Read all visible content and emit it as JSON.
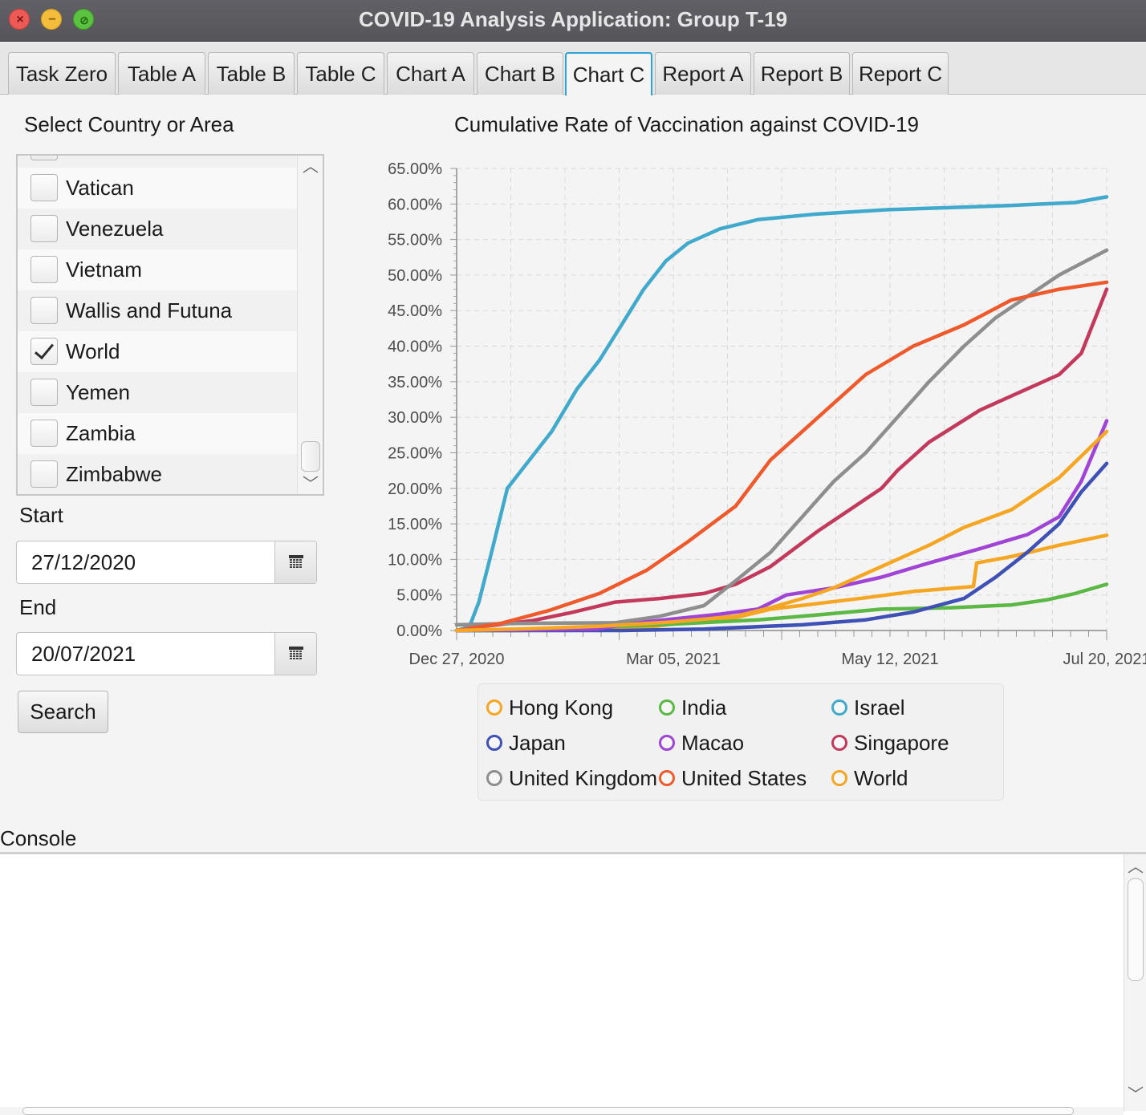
{
  "window": {
    "title": "COVID-19 Analysis Application: Group T-19"
  },
  "tabs": [
    {
      "label": "Task Zero",
      "active": false
    },
    {
      "label": "Table A",
      "active": false
    },
    {
      "label": "Table B",
      "active": false
    },
    {
      "label": "Table C",
      "active": false
    },
    {
      "label": "Chart A",
      "active": false
    },
    {
      "label": "Chart B",
      "active": false
    },
    {
      "label": "Chart C",
      "active": true
    },
    {
      "label": "Report A",
      "active": false
    },
    {
      "label": "Report B",
      "active": false
    },
    {
      "label": "Report C",
      "active": false
    }
  ],
  "sidebar": {
    "select_label": "Select Country or Area",
    "countries": [
      {
        "name": "Vatican",
        "checked": false
      },
      {
        "name": "Venezuela",
        "checked": false
      },
      {
        "name": "Vietnam",
        "checked": false
      },
      {
        "name": "Wallis and Futuna",
        "checked": false
      },
      {
        "name": "World",
        "checked": true
      },
      {
        "name": "Yemen",
        "checked": false
      },
      {
        "name": "Zambia",
        "checked": false
      },
      {
        "name": "Zimbabwe",
        "checked": false
      }
    ],
    "start_label": "Start",
    "start_value": "27/12/2020",
    "end_label": "End",
    "end_value": "20/07/2021",
    "search_label": "Search"
  },
  "console": {
    "label": "Console",
    "text": ""
  },
  "chart_data": {
    "type": "line",
    "title": "Cumulative Rate of Vaccination against COVID-19",
    "xlabel": "",
    "ylabel": "",
    "x_range": [
      "2020-12-27",
      "2021-07-20"
    ],
    "ylim": [
      0,
      65
    ],
    "yticks": [
      "0.00%",
      "5.00%",
      "10.00%",
      "15.00%",
      "20.00%",
      "25.00%",
      "30.00%",
      "35.00%",
      "40.00%",
      "45.00%",
      "50.00%",
      "55.00%",
      "60.00%",
      "65.00%"
    ],
    "xticks": [
      "Dec 27, 2020",
      "Mar 05, 2021",
      "May 12, 2021",
      "Jul 20, 2021"
    ],
    "grid": true,
    "legend_position": "bottom",
    "series": [
      {
        "name": "Hong Kong",
        "color": "#f5a623",
        "points": [
          [
            "2020-12-27",
            0
          ],
          [
            "2021-02-26",
            0.5
          ],
          [
            "2021-03-10",
            1.2
          ],
          [
            "2021-03-25",
            1.8
          ],
          [
            "2021-04-05",
            3
          ],
          [
            "2021-04-20",
            3.8
          ],
          [
            "2021-05-05",
            4.6
          ],
          [
            "2021-05-20",
            5.5
          ],
          [
            "2021-06-08",
            6.2
          ],
          [
            "2021-06-09",
            9.5
          ],
          [
            "2021-06-20",
            10.4
          ],
          [
            "2021-07-05",
            12
          ],
          [
            "2021-07-20",
            13.4
          ]
        ]
      },
      {
        "name": "India",
        "color": "#5cb845",
        "points": [
          [
            "2020-12-27",
            0
          ],
          [
            "2021-01-16",
            0
          ],
          [
            "2021-02-01",
            0.3
          ],
          [
            "2021-03-01",
            0.8
          ],
          [
            "2021-04-01",
            1.5
          ],
          [
            "2021-04-20",
            2.2
          ],
          [
            "2021-05-10",
            3
          ],
          [
            "2021-06-01",
            3.2
          ],
          [
            "2021-06-20",
            3.6
          ],
          [
            "2021-07-01",
            4.3
          ],
          [
            "2021-07-10",
            5.2
          ],
          [
            "2021-07-20",
            6.5
          ]
        ]
      },
      {
        "name": "Israel",
        "color": "#41a9cc",
        "points": [
          [
            "2020-12-27",
            0
          ],
          [
            "2020-12-31",
            0.5
          ],
          [
            "2021-01-03",
            4
          ],
          [
            "2021-01-07",
            11
          ],
          [
            "2021-01-12",
            20
          ],
          [
            "2021-01-19",
            24
          ],
          [
            "2021-01-26",
            28
          ],
          [
            "2021-02-03",
            34
          ],
          [
            "2021-02-10",
            38
          ],
          [
            "2021-02-17",
            43
          ],
          [
            "2021-02-24",
            48
          ],
          [
            "2021-03-03",
            52
          ],
          [
            "2021-03-10",
            54.5
          ],
          [
            "2021-03-20",
            56.5
          ],
          [
            "2021-04-01",
            57.8
          ],
          [
            "2021-04-20",
            58.6
          ],
          [
            "2021-05-12",
            59.2
          ],
          [
            "2021-06-01",
            59.5
          ],
          [
            "2021-06-20",
            59.8
          ],
          [
            "2021-07-10",
            60.2
          ],
          [
            "2021-07-20",
            61
          ]
        ]
      },
      {
        "name": "Japan",
        "color": "#3f51b5",
        "points": [
          [
            "2020-12-27",
            0
          ],
          [
            "2021-02-17",
            0
          ],
          [
            "2021-03-15",
            0.2
          ],
          [
            "2021-04-15",
            0.8
          ],
          [
            "2021-05-05",
            1.5
          ],
          [
            "2021-05-20",
            2.6
          ],
          [
            "2021-06-05",
            4.5
          ],
          [
            "2021-06-15",
            7.5
          ],
          [
            "2021-06-25",
            11
          ],
          [
            "2021-07-05",
            15
          ],
          [
            "2021-07-12",
            19.5
          ],
          [
            "2021-07-20",
            23.5
          ]
        ]
      },
      {
        "name": "Macao",
        "color": "#a044d6",
        "points": [
          [
            "2020-12-27",
            0
          ],
          [
            "2021-02-09",
            0.2
          ],
          [
            "2021-02-20",
            1
          ],
          [
            "2021-03-05",
            1.6
          ],
          [
            "2021-03-20",
            2.3
          ],
          [
            "2021-04-01",
            3
          ],
          [
            "2021-04-10",
            5
          ],
          [
            "2021-04-25",
            6
          ],
          [
            "2021-05-10",
            7.5
          ],
          [
            "2021-05-25",
            9.5
          ],
          [
            "2021-06-10",
            11.5
          ],
          [
            "2021-06-25",
            13.5
          ],
          [
            "2021-07-05",
            16
          ],
          [
            "2021-07-12",
            21
          ],
          [
            "2021-07-20",
            29.5
          ]
        ]
      },
      {
        "name": "Singapore",
        "color": "#c2395b",
        "points": [
          [
            "2020-12-27",
            0
          ],
          [
            "2021-01-05",
            0.6
          ],
          [
            "2021-01-20",
            1.4
          ],
          [
            "2021-02-01",
            2.5
          ],
          [
            "2021-02-15",
            4
          ],
          [
            "2021-03-01",
            4.5
          ],
          [
            "2021-03-15",
            5.2
          ],
          [
            "2021-03-25",
            6.5
          ],
          [
            "2021-04-05",
            9
          ],
          [
            "2021-04-20",
            14
          ],
          [
            "2021-05-10",
            20
          ],
          [
            "2021-05-15",
            22.5
          ],
          [
            "2021-05-25",
            26.5
          ],
          [
            "2021-06-10",
            31
          ],
          [
            "2021-06-25",
            34
          ],
          [
            "2021-07-05",
            36
          ],
          [
            "2021-07-12",
            39
          ],
          [
            "2021-07-20",
            48
          ]
        ]
      },
      {
        "name": "United Kingdom",
        "color": "#8e8e8e",
        "points": [
          [
            "2020-12-27",
            0.8
          ],
          [
            "2021-01-15",
            1
          ],
          [
            "2021-02-15",
            1.1
          ],
          [
            "2021-03-01",
            2
          ],
          [
            "2021-03-15",
            3.5
          ],
          [
            "2021-03-25",
            7
          ],
          [
            "2021-04-05",
            11
          ],
          [
            "2021-04-15",
            16
          ],
          [
            "2021-04-25",
            21
          ],
          [
            "2021-05-05",
            25
          ],
          [
            "2021-05-15",
            30
          ],
          [
            "2021-05-25",
            35
          ],
          [
            "2021-06-05",
            40
          ],
          [
            "2021-06-15",
            44
          ],
          [
            "2021-06-25",
            47
          ],
          [
            "2021-07-05",
            50
          ],
          [
            "2021-07-20",
            53.5
          ]
        ]
      },
      {
        "name": "United States",
        "color": "#ef5a2c",
        "points": [
          [
            "2020-12-27",
            0
          ],
          [
            "2021-01-10",
            1
          ],
          [
            "2021-01-25",
            2.8
          ],
          [
            "2021-02-10",
            5.2
          ],
          [
            "2021-02-25",
            8.5
          ],
          [
            "2021-03-10",
            12.5
          ],
          [
            "2021-03-25",
            17.5
          ],
          [
            "2021-04-05",
            24
          ],
          [
            "2021-04-15",
            28
          ],
          [
            "2021-04-25",
            32
          ],
          [
            "2021-05-05",
            36
          ],
          [
            "2021-05-20",
            40
          ],
          [
            "2021-06-05",
            43
          ],
          [
            "2021-06-20",
            46.5
          ],
          [
            "2021-07-05",
            48
          ],
          [
            "2021-07-20",
            49
          ]
        ]
      },
      {
        "name": "World",
        "color": "#f5a623",
        "points": [
          [
            "2020-12-27",
            0
          ],
          [
            "2021-01-15",
            0.2
          ],
          [
            "2021-02-10",
            0.6
          ],
          [
            "2021-03-05",
            1.2
          ],
          [
            "2021-03-25",
            2
          ],
          [
            "2021-04-05",
            3.2
          ],
          [
            "2021-04-15",
            4.5
          ],
          [
            "2021-04-25",
            6
          ],
          [
            "2021-05-05",
            8
          ],
          [
            "2021-05-15",
            10
          ],
          [
            "2021-05-25",
            12
          ],
          [
            "2021-06-05",
            14.5
          ],
          [
            "2021-06-20",
            17
          ],
          [
            "2021-07-05",
            21.5
          ],
          [
            "2021-07-20",
            28
          ]
        ]
      }
    ]
  }
}
